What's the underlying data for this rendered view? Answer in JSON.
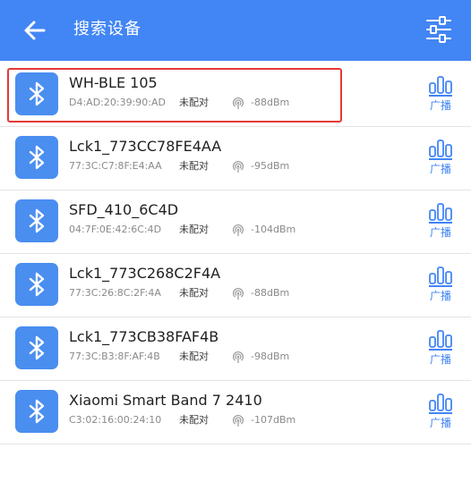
{
  "header": {
    "title": "搜索设备",
    "back_icon": "arrow-left-icon",
    "filter_icon": "sliders-icon",
    "background_color": "#4285f4"
  },
  "devices": [
    {
      "name": "WH-BLE 105",
      "mac": "D4:AD:20:39:90:AD",
      "status": "未配对",
      "rssi": "-88dBm",
      "action": "广播",
      "selected": true
    },
    {
      "name": "Lck1_773CC78FE4AA",
      "mac": "77:3C:C7:8F:E4:AA",
      "status": "未配对",
      "rssi": "-95dBm",
      "action": "广播",
      "selected": false
    },
    {
      "name": "SFD_410_6C4D",
      "mac": "04:7F:0E:42:6C:4D",
      "status": "未配对",
      "rssi": "-104dBm",
      "action": "广播",
      "selected": false
    },
    {
      "name": "Lck1_773C268C2F4A",
      "mac": "77:3C:26:8C:2F:4A",
      "status": "未配对",
      "rssi": "-88dBm",
      "action": "广播",
      "selected": false
    },
    {
      "name": "Lck1_773CB38FAF4B",
      "mac": "77:3C:B3:8F:AF:4B",
      "status": "未配对",
      "rssi": "-98dBm",
      "action": "广播",
      "selected": false
    },
    {
      "name": "Xiaomi Smart Band 7 2410",
      "mac": "C3:02:16:00:24:10",
      "status": "未配对",
      "rssi": "-107dBm",
      "action": "广播",
      "selected": false
    }
  ],
  "colors": {
    "accent": "#4285f4",
    "bluetooth_tile": "#4a8ef0",
    "highlight_border": "#e53935"
  }
}
